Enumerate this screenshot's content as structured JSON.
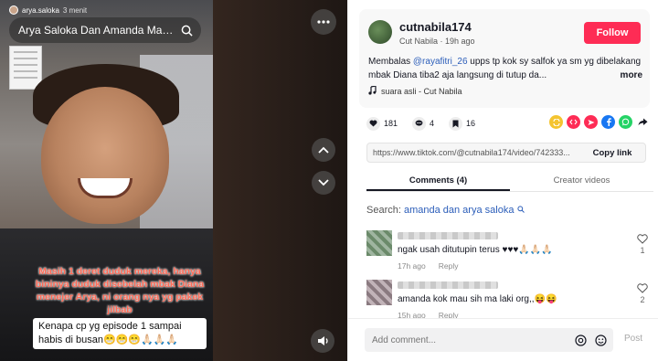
{
  "video": {
    "story_user": "arya.saloka",
    "story_time": "3 menit",
    "story_title": "Arya Saloka Dan Amanda Mano...",
    "caption_overlay": "Masih 1 deret duduk mereka, hanya bininya duduk disebelah mbak Diana menejer Arya, ni orang nya yg pakek jilbab",
    "caption_box": "Kenapa cp yg episode 1 sampai habis di busan😁😁😁🙏🏻🙏🏻🙏🏻"
  },
  "post": {
    "username": "cutnabila174",
    "display_name": "Cut Nabila",
    "time": "19h ago",
    "follow_label": "Follow",
    "desc_prefix": "Membalas ",
    "desc_mention": "@rayafitri_26",
    "desc_rest": " upps tp kok sy salfok ya sm yg dibelakang mbak Diana tiba2 aja langsung di tutup da...",
    "more_label": "more",
    "sound": "suara asli - Cut Nabila"
  },
  "actions": {
    "likes": "181",
    "comments": "4",
    "saves": "16"
  },
  "share": {
    "url": "https://www.tiktok.com/@cutnabila174/video/742333...",
    "copy_label": "Copy link",
    "icons": [
      {
        "name": "repost-icon",
        "color": "#f4c430"
      },
      {
        "name": "embed-icon",
        "color": "#fe2c55"
      },
      {
        "name": "send-icon",
        "color": "#fe2c55"
      },
      {
        "name": "facebook-icon",
        "color": "#1877f2"
      },
      {
        "name": "whatsapp-icon",
        "color": "#25d366"
      },
      {
        "name": "share-arrow-icon",
        "color": "#161823"
      }
    ]
  },
  "tabs": {
    "comments": "Comments (4)",
    "creator_videos": "Creator videos"
  },
  "search": {
    "label": "Search: ",
    "query": "amanda dan arya saloka"
  },
  "comments": [
    {
      "text": "ngak usah ditutupin terus ♥♥♥🙏🏻🙏🏻🙏🏻",
      "time": "17h ago",
      "reply": "Reply",
      "likes": "1"
    },
    {
      "text": "amanda kok mau sih ma laki org,,😝😝",
      "time": "15h ago",
      "reply": "Reply",
      "likes": "2"
    }
  ],
  "compose": {
    "placeholder": "Add comment...",
    "post_label": "Post"
  }
}
